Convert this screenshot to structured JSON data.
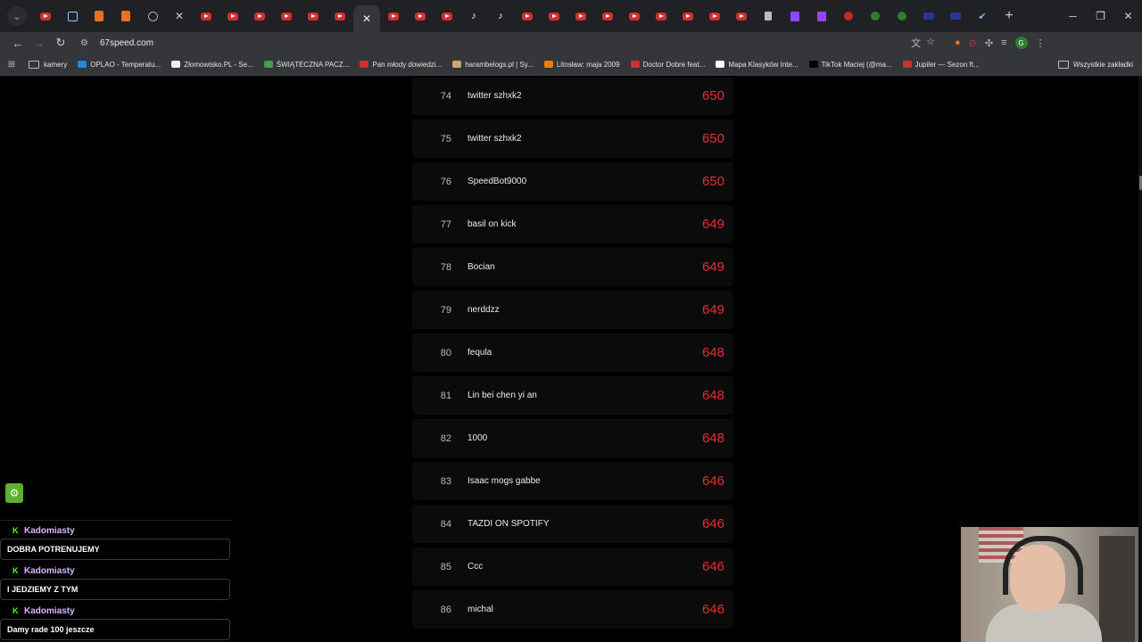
{
  "browser": {
    "url": "67speed.com",
    "tabs": [
      "yt",
      "chk",
      "orange",
      "orange",
      "grey",
      "x",
      "yt",
      "yt",
      "yt",
      "yt",
      "yt",
      "yt",
      "active",
      "yt",
      "yt",
      "yt",
      "tt",
      "tt",
      "yt",
      "yt",
      "yt",
      "yt",
      "yt",
      "yt",
      "yt",
      "yt",
      "yt",
      "doc",
      "twitch",
      "twitch",
      "circle",
      "green",
      "green",
      "blue",
      "blue",
      "steam"
    ],
    "bookmarks": [
      {
        "label": "kamery",
        "icon": "folder"
      },
      {
        "label": "OPLAO - Temperatu...",
        "icon": "#1e88e5"
      },
      {
        "label": "Złomowisko.PL - Se...",
        "icon": "#eeeeee"
      },
      {
        "label": "ŚWIĄTECZNA PACZ...",
        "icon": "#43a047"
      },
      {
        "label": "Pan młody dowiedzi...",
        "icon": "#d32f2f"
      },
      {
        "label": "harambelogs.pl | Sy...",
        "icon": "#c9a86a"
      },
      {
        "label": "Litosław: maja 2009",
        "icon": "#f57c00"
      },
      {
        "label": "Doctor Dobre feat...",
        "icon": "#d32f2f"
      },
      {
        "label": "Mapa Klasyków Inte...",
        "icon": "#ffffff"
      },
      {
        "label": "TikTok Maciej (@ma...",
        "icon": "#000000"
      },
      {
        "label": "Jupiler — Sezon ft...",
        "icon": "#d32f2f"
      }
    ],
    "all_bookmarks": "Wszystkie zakładki"
  },
  "leaderboard": [
    {
      "rank": "74",
      "name": "twitter szhxk2",
      "score": "650"
    },
    {
      "rank": "75",
      "name": "twitter szhxk2",
      "score": "650"
    },
    {
      "rank": "76",
      "name": "SpeedBot9000",
      "score": "650"
    },
    {
      "rank": "77",
      "name": "basil on kick",
      "score": "649"
    },
    {
      "rank": "78",
      "name": "Bocian",
      "score": "649"
    },
    {
      "rank": "79",
      "name": "nerddzz",
      "score": "649"
    },
    {
      "rank": "80",
      "name": "fequla",
      "score": "648"
    },
    {
      "rank": "81",
      "name": "Lin bei chen yi an",
      "score": "648"
    },
    {
      "rank": "82",
      "name": "1000",
      "score": "648"
    },
    {
      "rank": "83",
      "name": "Isaac mogs gabbe",
      "score": "646"
    },
    {
      "rank": "84",
      "name": "TAZDI ON SPOTIFY",
      "score": "646"
    },
    {
      "rank": "85",
      "name": "Ccc",
      "score": "646"
    },
    {
      "rank": "86",
      "name": "michal",
      "score": "646"
    }
  ],
  "chat": [
    {
      "user": "Kadomiasty",
      "text": "DOBRA POTRENUJEMY"
    },
    {
      "user": "Kadomiasty",
      "text": "I JEDZIEMY Z TYM"
    },
    {
      "user": "Kadomiasty",
      "text": "Damy rade 100 jeszcze"
    }
  ],
  "colors": {
    "score": "#e0312d",
    "username": "#d7b7ff",
    "kick": "#53fc18"
  }
}
